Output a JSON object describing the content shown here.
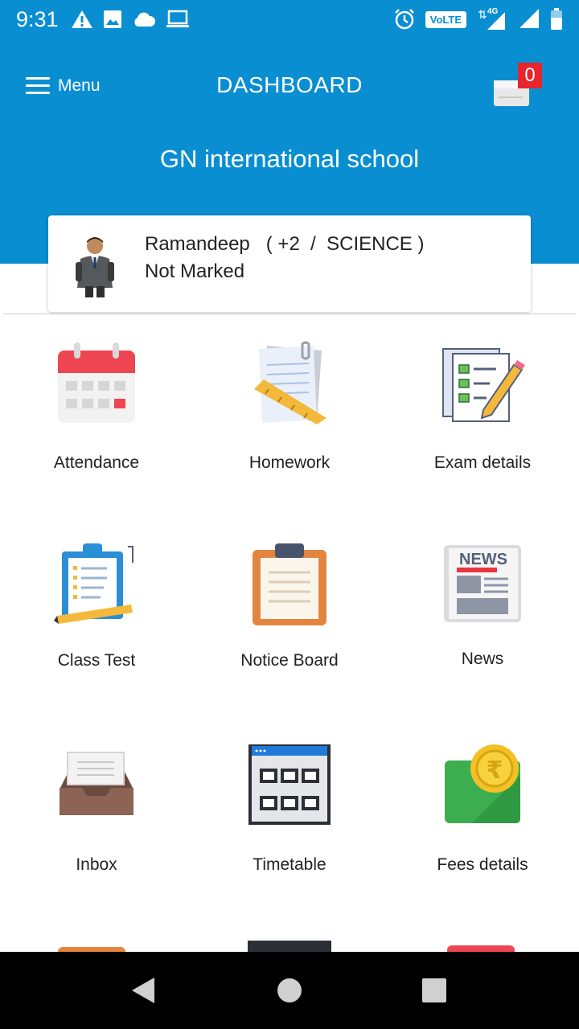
{
  "status_bar": {
    "time": "9:31",
    "network_label": "VoLTE",
    "network_type": "4G",
    "icons": [
      "warning-icon",
      "image-icon",
      "cloud-icon",
      "laptop-icon",
      "alarm-icon",
      "signal-icon",
      "battery-icon"
    ]
  },
  "header": {
    "menu_label": "Menu",
    "title": "DASHBOARD",
    "inbox_count": "0",
    "school_name": "GN international school",
    "bg_color": "#0a8ed2"
  },
  "student": {
    "name_line": "Ramandeep   ( +2  /  SCIENCE )",
    "status": "Not Marked"
  },
  "tiles": [
    {
      "label": "Attendance",
      "icon": "calendar-icon"
    },
    {
      "label": "Homework",
      "icon": "homework-icon"
    },
    {
      "label": "Exam details",
      "icon": "exam-checklist-icon"
    },
    {
      "label": "Class Test",
      "icon": "clipboard-test-icon"
    },
    {
      "label": "Notice Board",
      "icon": "notice-board-icon"
    },
    {
      "label": "News",
      "icon": "newspaper-icon"
    },
    {
      "label": "Inbox",
      "icon": "inbox-tray-icon"
    },
    {
      "label": "Timetable",
      "icon": "timetable-icon"
    },
    {
      "label": "Fees details",
      "icon": "rupee-coin-icon"
    }
  ],
  "news_icon_text": "NEWS",
  "rupee_symbol": "₹"
}
